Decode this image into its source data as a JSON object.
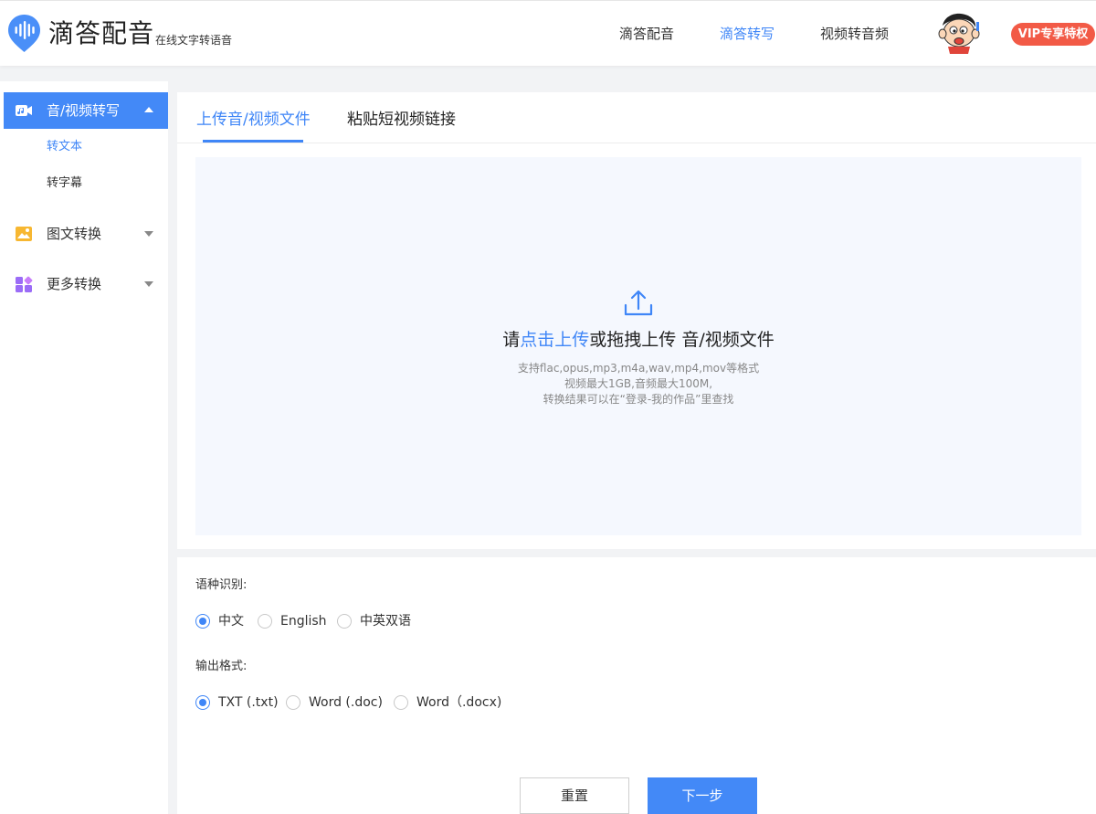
{
  "header": {
    "logo_title": "滴答配音",
    "logo_subtitle": "在线文字转语音",
    "nav": [
      {
        "label": "滴答配音",
        "active": false
      },
      {
        "label": "滴答转写",
        "active": true
      },
      {
        "label": "视频转音频",
        "active": false
      }
    ],
    "vip_label": "VIP专享特权",
    "accent_color": "#3f86f7",
    "vip_color": "#f25a46"
  },
  "sidebar": {
    "groups": [
      {
        "label": "音/视频转写",
        "icon": "video-camera-icon",
        "expanded": true,
        "active": true,
        "children": [
          {
            "label": "转文本",
            "active": true
          },
          {
            "label": "转字幕",
            "active": false
          }
        ]
      },
      {
        "label": "图文转换",
        "icon": "image-icon",
        "expanded": false,
        "active": false
      },
      {
        "label": "更多转换",
        "icon": "apps-grid-icon",
        "expanded": false,
        "active": false
      }
    ]
  },
  "upload": {
    "tabs": [
      {
        "label": "上传音/视频文件",
        "active": true
      },
      {
        "label": "粘贴短视频链接",
        "active": false
      }
    ],
    "prompt_prefix": "请",
    "prompt_link": "点击上传",
    "prompt_suffix": "或拖拽上传 音/视频文件",
    "hints": [
      "支持flac,opus,mp3,m4a,wav,mp4,mov等格式",
      "视频最大1GB,音频最大100M,",
      "转换结果可以在“登录-我的作品”里查找"
    ]
  },
  "settings": {
    "language_label": "语种识别:",
    "language_options": [
      {
        "label": "中文",
        "checked": true
      },
      {
        "label": "English",
        "checked": false
      },
      {
        "label": "中英双语",
        "checked": false
      }
    ],
    "format_label": "输出格式:",
    "format_options": [
      {
        "label": "TXT (.txt)",
        "checked": true
      },
      {
        "label": "Word (.doc)",
        "checked": false
      },
      {
        "label": "Word（.docx)",
        "checked": false
      }
    ]
  },
  "actions": {
    "reset_label": "重置",
    "next_label": "下一步"
  }
}
